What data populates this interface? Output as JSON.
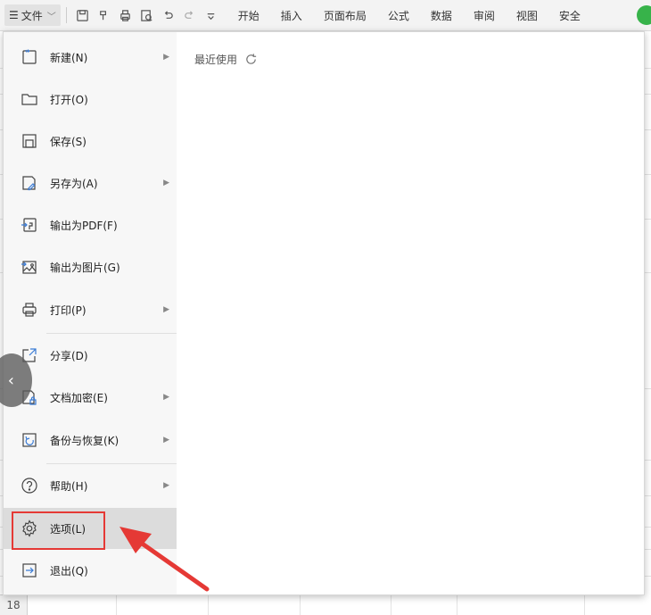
{
  "toolbar": {
    "file_label": "文件",
    "tabs": [
      "开始",
      "插入",
      "页面布局",
      "公式",
      "数据",
      "审阅",
      "视图",
      "安全"
    ]
  },
  "menu": {
    "items": [
      {
        "label": "新建(N)",
        "icon": "new-file-icon",
        "has_submenu": true
      },
      {
        "label": "打开(O)",
        "icon": "folder-open-icon",
        "has_submenu": false
      },
      {
        "label": "保存(S)",
        "icon": "save-icon",
        "has_submenu": false
      },
      {
        "label": "另存为(A)",
        "icon": "save-as-icon",
        "has_submenu": true
      },
      {
        "label": "输出为PDF(F)",
        "icon": "export-pdf-icon",
        "has_submenu": false
      },
      {
        "label": "输出为图片(G)",
        "icon": "export-image-icon",
        "has_submenu": false
      },
      {
        "label": "打印(P)",
        "icon": "printer-icon",
        "has_submenu": true
      },
      {
        "label": "分享(D)",
        "icon": "share-icon",
        "has_submenu": false
      },
      {
        "label": "文档加密(E)",
        "icon": "encrypt-icon",
        "has_submenu": true
      },
      {
        "label": "备份与恢复(K)",
        "icon": "backup-icon",
        "has_submenu": true
      },
      {
        "label": "帮助(H)",
        "icon": "help-icon",
        "has_submenu": true
      },
      {
        "label": "选项(L)",
        "icon": "gear-icon",
        "has_submenu": false,
        "selected": true
      },
      {
        "label": "退出(Q)",
        "icon": "exit-icon",
        "has_submenu": false
      }
    ]
  },
  "recent": {
    "label": "最近使用"
  },
  "sheet": {
    "row_number": "18"
  },
  "colors": {
    "highlight": "#e53935",
    "arrow": "#e53935",
    "status_green": "#37b34a"
  }
}
